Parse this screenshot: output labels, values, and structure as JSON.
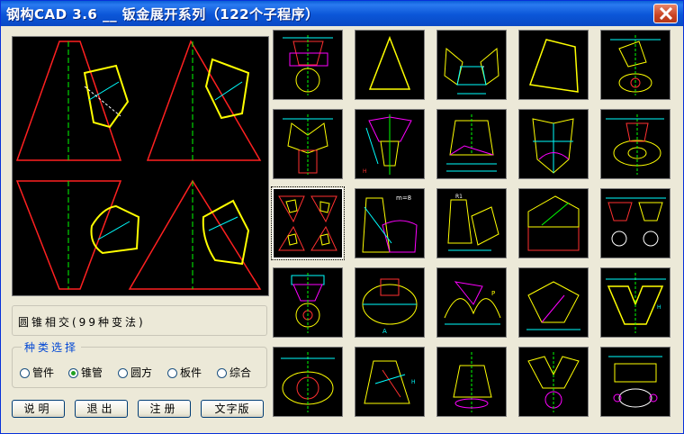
{
  "window": {
    "title": "钢构CAD 3.6 __ 钣金展开系列（122个子程序）",
    "accent": "#0a5fd6"
  },
  "preview": {
    "description_label": "圆锥相交(99种变法)"
  },
  "category_group": {
    "legend": "种类选择",
    "options": [
      "管件",
      "锥管",
      "圆方",
      "板件",
      "综合"
    ],
    "selected": "锥管"
  },
  "buttons": {
    "help": "说明",
    "exit": "退出",
    "register": "注册",
    "text_version": "文字版"
  },
  "thumbnails": {
    "count": 25,
    "selected_index": 10,
    "labels": {
      "t11": "m=8",
      "t12": "R1",
      "t17": "A",
      "t18": "P",
      "t20": "H",
      "t22": "H"
    }
  }
}
